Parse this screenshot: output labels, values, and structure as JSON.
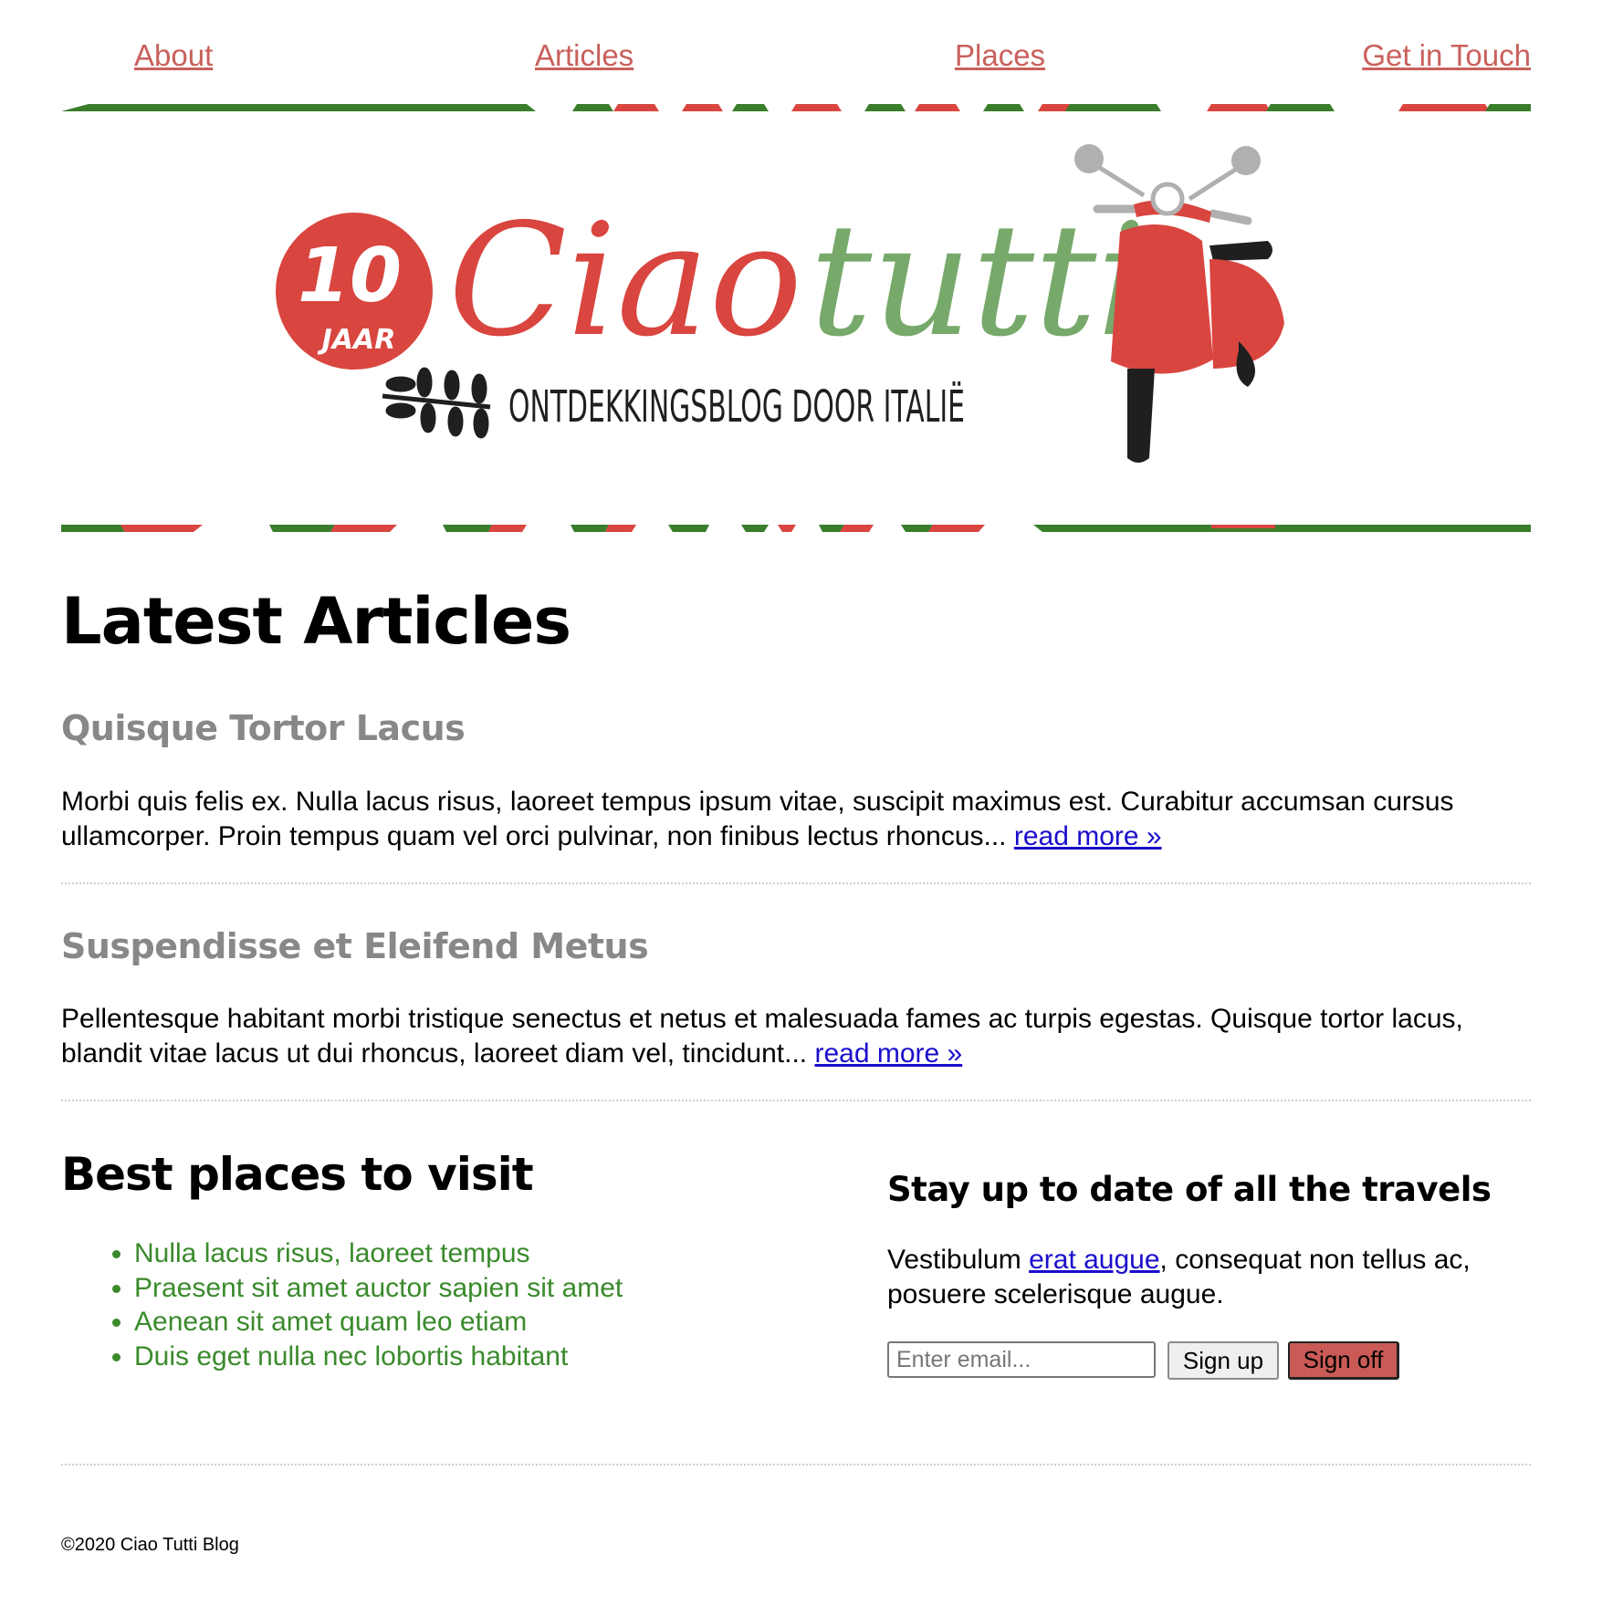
{
  "nav": {
    "items": [
      {
        "label": "About"
      },
      {
        "label": "Articles"
      },
      {
        "label": "Places"
      },
      {
        "label": "Get in Touch"
      }
    ],
    "color": "#c9605c"
  },
  "banner": {
    "badge_number": "10",
    "badge_word": "JAAR",
    "title_part1": "Ciao",
    "title_part2": "tutti",
    "tagline": "ONTDEKKINGSBLOG DOOR ITALIË",
    "colors": {
      "red": "#d9453f",
      "green": "#77a96a",
      "stripe_green": "#3a7d2b"
    }
  },
  "latest": {
    "heading": "Latest Articles",
    "articles": [
      {
        "title": "Quisque Tortor Lacus",
        "body": "Morbi quis felis ex. Nulla lacus risus, laoreet tempus ipsum vitae, suscipit maximus est. Curabitur accumsan cursus ullamcorper. Proin tempus quam vel orci pulvinar, non finibus lectus rhoncus... ",
        "link": "read more »"
      },
      {
        "title": "Suspendisse et Eleifend Metus",
        "body": "Pellentesque habitant morbi tristique senectus et netus et malesuada fames ac turpis egestas. Quisque tortor lacus, blandit vitae lacus ut dui rhoncus, laoreet diam vel, tincidunt... ",
        "link": "read more »"
      }
    ]
  },
  "places": {
    "heading": "Best places to visit",
    "items": [
      "Nulla lacus risus, laoreet tempus",
      "Praesent sit amet auctor sapien sit amet",
      "Aenean sit amet quam leo etiam",
      "Duis eget nulla nec lobortis habitant"
    ],
    "color": "#3a8a2c"
  },
  "subscribe": {
    "heading": "Stay up to date of all the travels",
    "text_before": "Vestibulum ",
    "link": "erat augue",
    "text_after": ", consequat non tellus ac, posuere scelerisque augue.",
    "email_placeholder": "Enter email...",
    "signup_label": "Sign up",
    "signoff_label": "Sign off"
  },
  "footer": {
    "copyright": "©2020 Ciao Tutti Blog"
  }
}
